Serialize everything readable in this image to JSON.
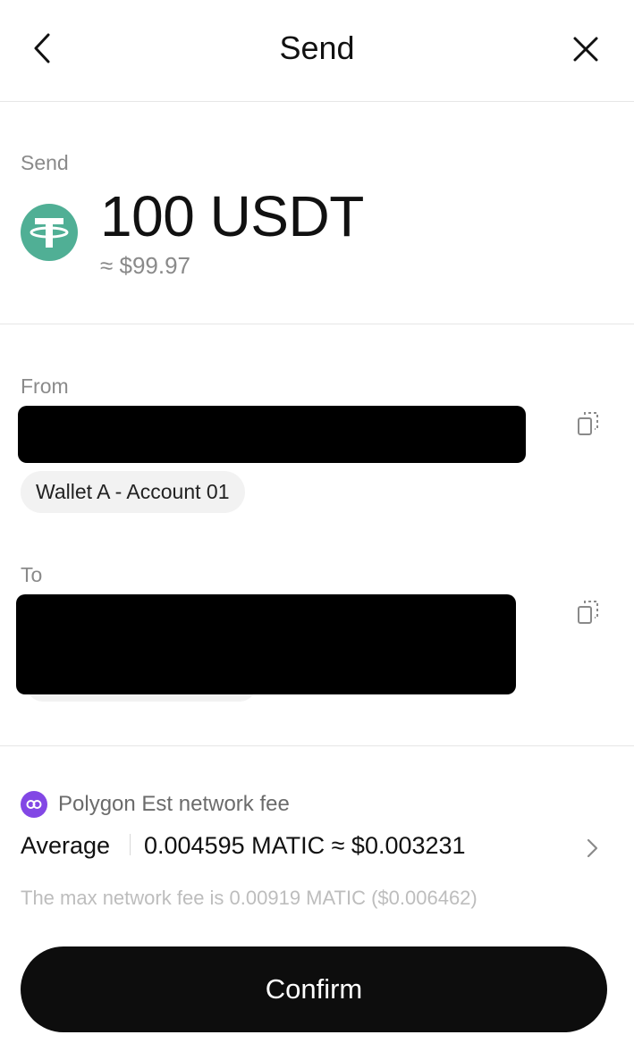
{
  "header": {
    "title": "Send",
    "back_icon": "chevron-left-icon",
    "close_icon": "close-icon"
  },
  "amount": {
    "label": "Send",
    "token_icon": "tether-icon",
    "token_color": "#50AF95",
    "value": "100 USDT",
    "fiat": "≈ $99.97"
  },
  "from": {
    "label": "From",
    "address": "",
    "wallet": "Wallet A - Account 01"
  },
  "to": {
    "label": "To",
    "address": ""
  },
  "fee": {
    "network_icon": "polygon-icon",
    "network_color": "#8247E5",
    "network_label": "Polygon Est network fee",
    "speed": "Average",
    "value": "0.004595 MATIC ≈ $0.003231",
    "max_note": "The max network fee is 0.00919 MATIC ($0.006462)"
  },
  "actions": {
    "confirm_label": "Confirm"
  }
}
